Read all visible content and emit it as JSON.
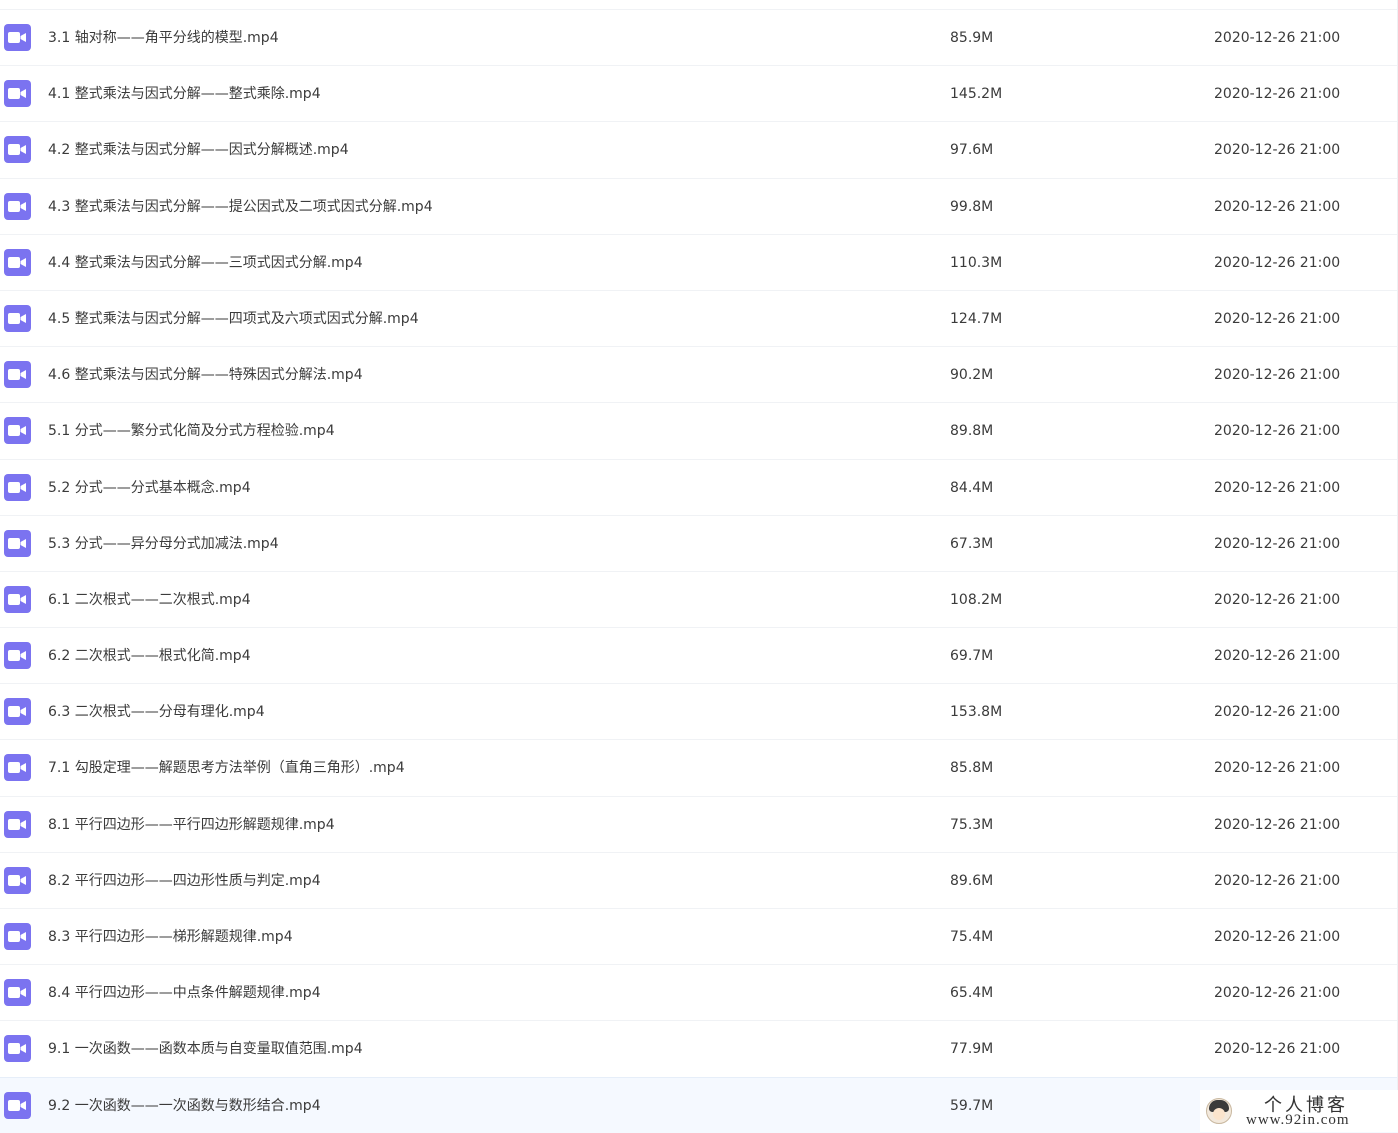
{
  "accent_color": "#7b73f0",
  "files": [
    {
      "name": "3.1 轴对称——角平分线的模型.mp4",
      "size": "85.9M",
      "date": "2020-12-26 21:00"
    },
    {
      "name": "4.1 整式乘法与因式分解——整式乘除.mp4",
      "size": "145.2M",
      "date": "2020-12-26 21:00"
    },
    {
      "name": "4.2 整式乘法与因式分解——因式分解概述.mp4",
      "size": "97.6M",
      "date": "2020-12-26 21:00"
    },
    {
      "name": "4.3 整式乘法与因式分解——提公因式及二项式因式分解.mp4",
      "size": "99.8M",
      "date": "2020-12-26 21:00"
    },
    {
      "name": "4.4 整式乘法与因式分解——三项式因式分解.mp4",
      "size": "110.3M",
      "date": "2020-12-26 21:00"
    },
    {
      "name": "4.5 整式乘法与因式分解——四项式及六项式因式分解.mp4",
      "size": "124.7M",
      "date": "2020-12-26 21:00"
    },
    {
      "name": "4.6 整式乘法与因式分解——特殊因式分解法.mp4",
      "size": "90.2M",
      "date": "2020-12-26 21:00"
    },
    {
      "name": "5.1 分式——繁分式化简及分式方程检验.mp4",
      "size": "89.8M",
      "date": "2020-12-26 21:00"
    },
    {
      "name": "5.2 分式——分式基本概念.mp4",
      "size": "84.4M",
      "date": "2020-12-26 21:00"
    },
    {
      "name": "5.3 分式——异分母分式加减法.mp4",
      "size": "67.3M",
      "date": "2020-12-26 21:00"
    },
    {
      "name": "6.1 二次根式——二次根式.mp4",
      "size": "108.2M",
      "date": "2020-12-26 21:00"
    },
    {
      "name": "6.2 二次根式——根式化简.mp4",
      "size": "69.7M",
      "date": "2020-12-26 21:00"
    },
    {
      "name": "6.3 二次根式——分母有理化.mp4",
      "size": "153.8M",
      "date": "2020-12-26 21:00"
    },
    {
      "name": "7.1 勾股定理——解题思考方法举例（直角三角形）.mp4",
      "size": "85.8M",
      "date": "2020-12-26 21:00"
    },
    {
      "name": "8.1 平行四边形——平行四边形解题规律.mp4",
      "size": "75.3M",
      "date": "2020-12-26 21:00"
    },
    {
      "name": "8.2 平行四边形——四边形性质与判定.mp4",
      "size": "89.6M",
      "date": "2020-12-26 21:00"
    },
    {
      "name": "8.3 平行四边形——梯形解题规律.mp4",
      "size": "75.4M",
      "date": "2020-12-26 21:00"
    },
    {
      "name": "8.4 平行四边形——中点条件解题规律.mp4",
      "size": "65.4M",
      "date": "2020-12-26 21:00"
    },
    {
      "name": "9.1 一次函数——函数本质与自变量取值范围.mp4",
      "size": "77.9M",
      "date": "2020-12-26 21:00"
    },
    {
      "name": "9.2 一次函数——一次函数与数形结合.mp4",
      "size": "59.7M",
      "date": ""
    }
  ],
  "watermark": {
    "title": "个人博客",
    "url": "www.92in.com"
  }
}
